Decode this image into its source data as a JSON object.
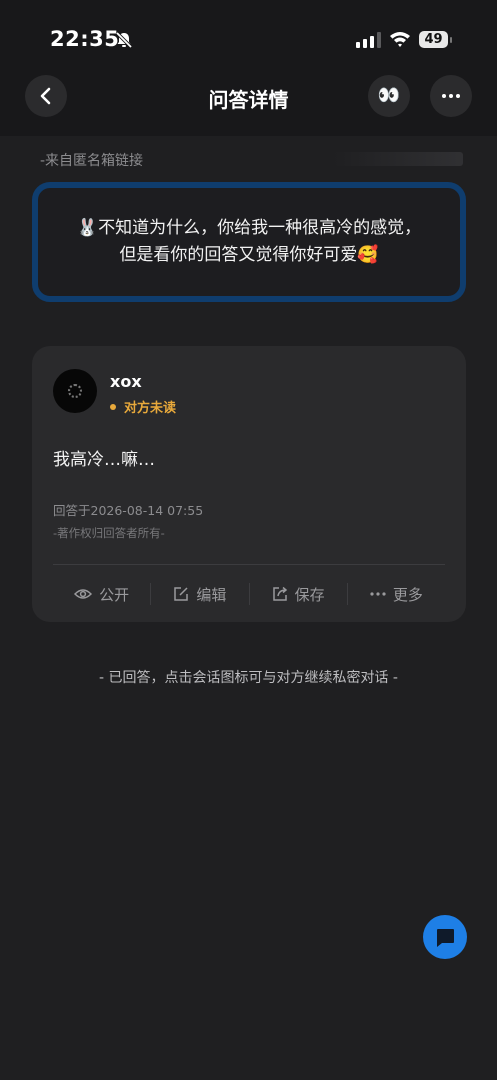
{
  "status_bar": {
    "time": "22:35",
    "battery": "49"
  },
  "header": {
    "title": "问答详情",
    "eyes_emoji": "👀"
  },
  "source_label": "-来自匿名箱链接",
  "question": {
    "text": "🐰不知道为什么，你给我一种很高冷的感觉，但是看你的回答又觉得你好可爱🥰"
  },
  "answer": {
    "user_name": "xox",
    "read_status": "对方未读",
    "text": "我高冷…嘛…",
    "time": "回答于2026-08-14 07:55",
    "copyright": "-著作权归回答者所有-",
    "actions": {
      "public": "公开",
      "edit": "编辑",
      "save": "保存",
      "more": "更多"
    }
  },
  "footer_note": "- 已回答，点击会话图标可与对方继续私密对话 -",
  "colors": {
    "accent_blue": "#1e7fe6",
    "question_border": "#0f3d6e",
    "unread_orange": "#e8a93b"
  }
}
